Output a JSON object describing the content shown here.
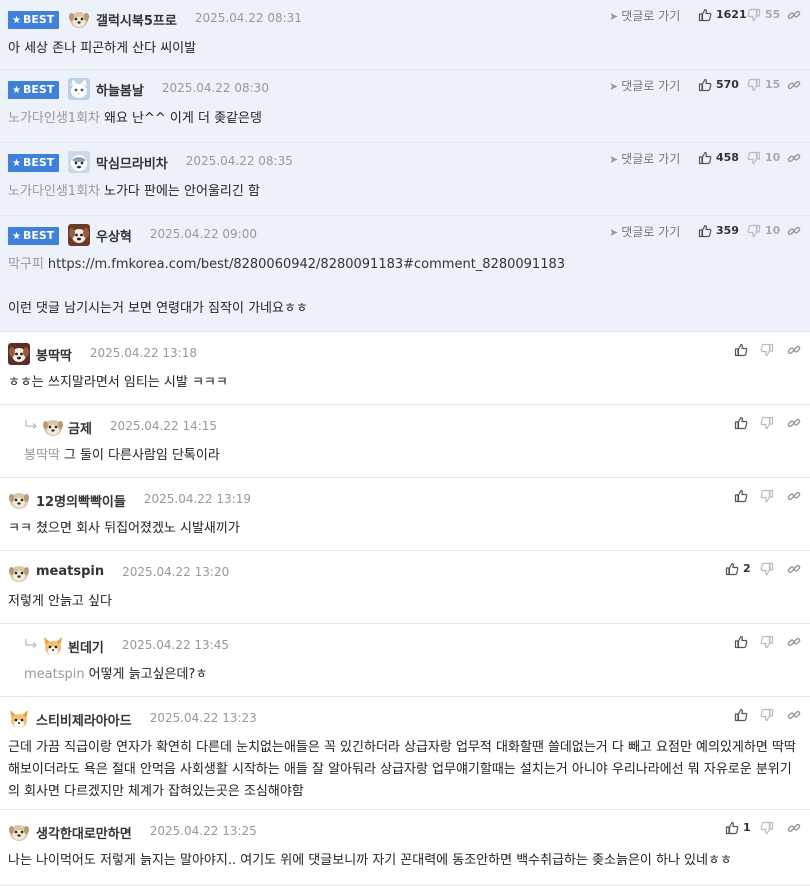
{
  "ui": {
    "best_label": "BEST",
    "goto_label": "댓글로 가기"
  },
  "comments": [
    {
      "best": true,
      "nick": "갤럭시북5프로",
      "date": "2025.04.22 08:31",
      "to": "",
      "text": "아 세상 존나 피곤하게 산다 씨이발",
      "likes": "1621",
      "dislikes": "55"
    },
    {
      "best": true,
      "nick": "하늘봄날",
      "date": "2025.04.22 08:30",
      "to": "노가다인생1회차",
      "text": "왜요 난^^ 이게 더 좆같은뎅",
      "likes": "570",
      "dislikes": "15"
    },
    {
      "best": true,
      "nick": "막심므라비차",
      "date": "2025.04.22 08:35",
      "to": "노가다인생1회차",
      "text": "노가다 판에는 안어울리긴 함",
      "likes": "458",
      "dislikes": "10"
    },
    {
      "best": true,
      "nick": "우상혁",
      "date": "2025.04.22 09:00",
      "to": "막구피",
      "text": "https://m.fmkorea.com/best/8280060942/8280091183#comment_8280091183",
      "text2": "이런 댓글 남기시는거 보면 연령대가 짐작이 가네요ㅎㅎ",
      "likes": "359",
      "dislikes": "10"
    },
    {
      "best": false,
      "nick": "봉딱딱",
      "date": "2025.04.22 13:18",
      "to": "",
      "text": "ㅎㅎ는 쓰지말라면서 임티는 시발 ㅋㅋㅋ",
      "likes": "",
      "dislikes": ""
    },
    {
      "best": false,
      "reply": true,
      "nick": "금제",
      "date": "2025.04.22 14:15",
      "to": "봉딱딱",
      "text": "그 둘이 다른사람임 단톡이라",
      "likes": "",
      "dislikes": ""
    },
    {
      "best": false,
      "nick": "12명의빡빡이들",
      "date": "2025.04.22 13:19",
      "to": "",
      "text": "ㅋㅋ 쳤으면 회사 뒤집어졌겠노 시발새끼가",
      "likes": "",
      "dislikes": ""
    },
    {
      "best": false,
      "nick": "meatspin",
      "date": "2025.04.22 13:20",
      "to": "",
      "text": "저렇게 안늙고 싶다",
      "likes": "2",
      "dislikes": ""
    },
    {
      "best": false,
      "reply": true,
      "nick": "뵌데기",
      "date": "2025.04.22 13:45",
      "to": "meatspin",
      "text": "어떻게 늙고싶은데?ㅎ",
      "likes": "",
      "dislikes": ""
    },
    {
      "best": false,
      "nick": "스티비제라아아드",
      "date": "2025.04.22 13:23",
      "to": "",
      "text": "근데 가끔 직급이랑 연자가 확연히 다른데 눈치없는애들은 꼭 있긴하더라 상급자랑 업무적 대화할땐 쓸데없는거 다 빼고 요점만 예의있게하면 딱딱해보이더라도 욕은 절대 안먹음 사회생활 시작하는 애들 잘 알아둬라 상급자랑 업무얘기할때는 설치는거 아니야 우리나라에선 뭐 자유로운 분위기의 회사면 다르겠지만 체계가 잡혀있는곳은 조심해야함",
      "likes": "",
      "dislikes": ""
    },
    {
      "best": false,
      "nick": "생각한대로만하면",
      "date": "2025.04.22 13:25",
      "to": "",
      "text": "나는 나이먹어도 저렇게 늙지는 말아야지.. 여기도 위에 댓글보니까 자기 꼰대력에 동조안하면 백수취급하는 좆소늙은이 하나 있네ㅎㅎ",
      "likes": "1",
      "dislikes": ""
    }
  ]
}
